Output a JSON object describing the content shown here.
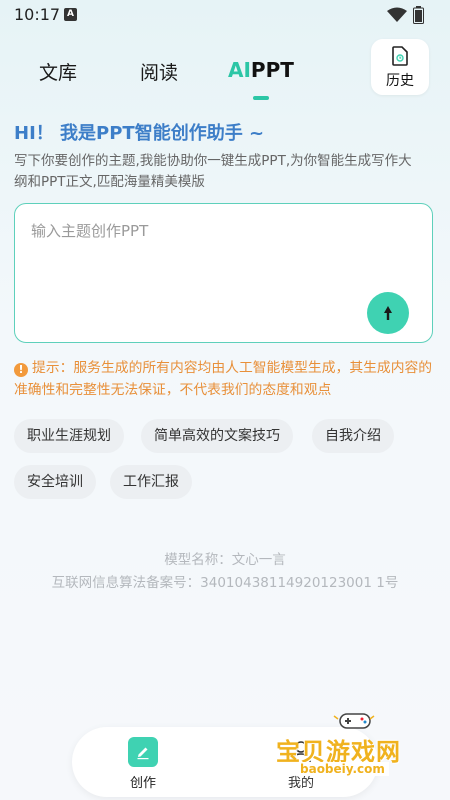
{
  "status_bar": {
    "time": "10:17",
    "notification_letter": "A"
  },
  "tabs": [
    {
      "label": "文库",
      "active": false
    },
    {
      "label": "阅读",
      "active": false
    },
    {
      "label_ai": "AI",
      "label_ppt": "PPT",
      "active": true
    }
  ],
  "history": {
    "label": "历史"
  },
  "greeting": "HI！ 我是PPT智能创作助手 ~",
  "intro": "写下你要创作的主题,我能协助你一键生成PPT,为你智能生成写作大纲和PPT正文,匹配海量精美模版",
  "input": {
    "placeholder": "输入主题创作PPT",
    "value": ""
  },
  "notice": "提示：服务生成的所有内容均由人工智能模型生成，其生成内容的准确性和完整性无法保证，不代表我们的态度和观点",
  "suggestions": [
    "职业生涯规划",
    "简单高效的文案技巧",
    "自我介绍",
    "安全培训",
    "工作汇报"
  ],
  "model_name": "模型名称：文心一言",
  "filing": "互联网信息算法备案号：34010438114920123001 1号",
  "bottom_nav": [
    {
      "label": "创作",
      "icon": "pencil-icon",
      "active": true
    },
    {
      "label": "我的",
      "icon": "user-icon",
      "active": false
    }
  ],
  "watermark": {
    "text": "宝贝游戏网",
    "url": "baobeiy.com"
  },
  "colors": {
    "accent": "#3fd2b2",
    "greeting": "#3d7ec8",
    "notice": "#e8903a"
  }
}
